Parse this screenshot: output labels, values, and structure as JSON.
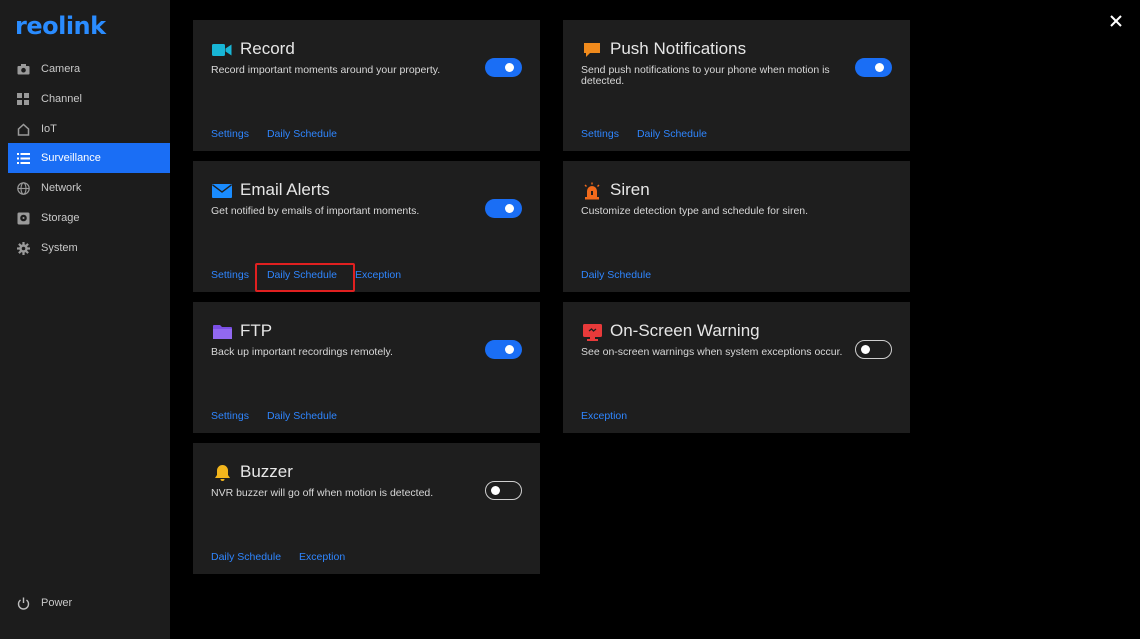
{
  "brand": {
    "logo_text": "reolink",
    "accent": "#1a6ef5",
    "link_color": "#2f86ff"
  },
  "sidebar": {
    "items": [
      {
        "label": "Camera",
        "icon": "camera-icon",
        "active": false
      },
      {
        "label": "Channel",
        "icon": "channel-grid-icon",
        "active": false
      },
      {
        "label": "IoT",
        "icon": "iot-home-icon",
        "active": false
      },
      {
        "label": "Surveillance",
        "icon": "list-icon",
        "active": true
      },
      {
        "label": "Network",
        "icon": "globe-icon",
        "active": false
      },
      {
        "label": "Storage",
        "icon": "storage-icon",
        "active": false
      },
      {
        "label": "System",
        "icon": "gear-icon",
        "active": false
      }
    ],
    "power_label": "Power"
  },
  "cards": {
    "record": {
      "title": "Record",
      "desc": "Record important moments around your property.",
      "toggle": "on",
      "links": [
        "Settings",
        "Daily Schedule"
      ]
    },
    "push": {
      "title": "Push Notifications",
      "desc": "Send push notifications to your phone when motion is detected.",
      "toggle": "on",
      "links": [
        "Settings",
        "Daily Schedule"
      ]
    },
    "email": {
      "title": "Email Alerts",
      "desc": "Get notified by emails of important moments.",
      "toggle": "on",
      "links": [
        "Settings",
        "Daily Schedule",
        "Exception"
      ]
    },
    "siren": {
      "title": "Siren",
      "desc": "Customize detection type and schedule for siren.",
      "links": [
        "Daily Schedule"
      ]
    },
    "ftp": {
      "title": "FTP",
      "desc": "Back up important recordings remotely.",
      "toggle": "on",
      "links": [
        "Settings",
        "Daily Schedule"
      ]
    },
    "onscreen": {
      "title": "On-Screen Warning",
      "desc": "See on-screen warnings when system exceptions occur.",
      "toggle": "off",
      "links": [
        "Exception"
      ]
    },
    "buzzer": {
      "title": "Buzzer",
      "desc": "NVR buzzer will go off when motion is detected.",
      "toggle": "off",
      "links": [
        "Daily Schedule",
        "Exception"
      ]
    }
  }
}
